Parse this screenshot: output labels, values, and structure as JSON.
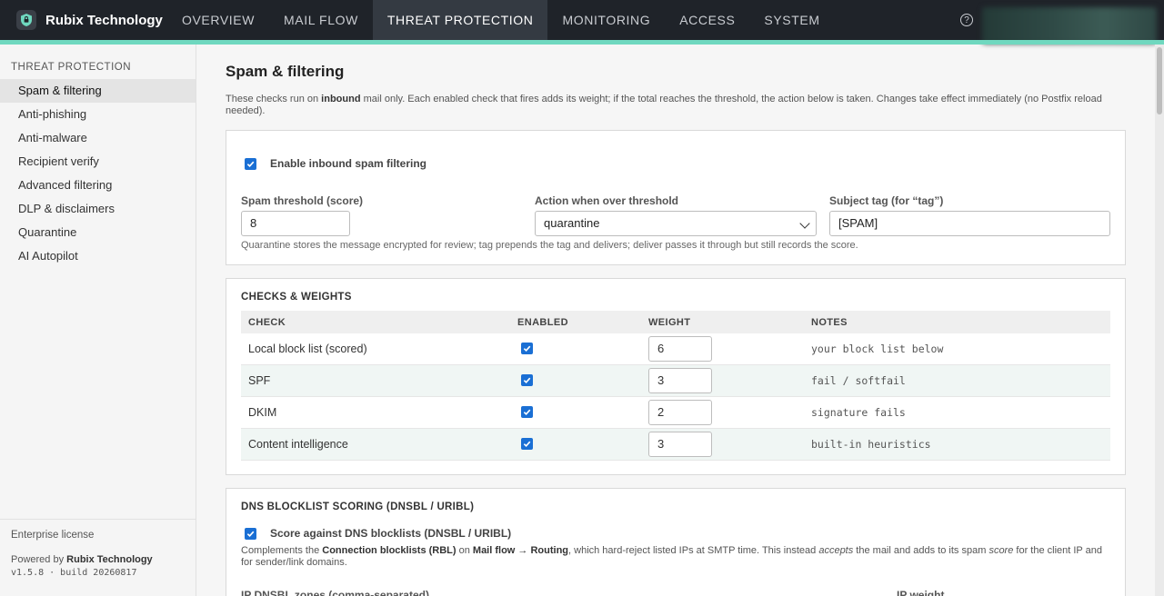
{
  "brand": {
    "name": "Rubix Technology"
  },
  "nav": [
    {
      "label": "OVERVIEW"
    },
    {
      "label": "MAIL FLOW"
    },
    {
      "label": "THREAT PROTECTION"
    },
    {
      "label": "MONITORING"
    },
    {
      "label": "ACCESS"
    },
    {
      "label": "SYSTEM"
    }
  ],
  "help_glyph": "?",
  "sidebar": {
    "heading": "THREAT PROTECTION",
    "items": [
      {
        "label": "Spam & filtering"
      },
      {
        "label": "Anti-phishing"
      },
      {
        "label": "Anti-malware"
      },
      {
        "label": "Recipient verify"
      },
      {
        "label": "Advanced filtering"
      },
      {
        "label": "DLP & disclaimers"
      },
      {
        "label": "Quarantine"
      },
      {
        "label": "AI Autopilot"
      }
    ],
    "license": "Enterprise license",
    "powered_prefix": "Powered by ",
    "powered_name": "Rubix Technology",
    "version": "v1.5.8 · build 20260817"
  },
  "page": {
    "title": "Spam & filtering",
    "intro_1": "These checks run on ",
    "intro_bold": "inbound",
    "intro_2": " mail only. Each enabled check that fires adds its weight; if the total reaches the threshold, the action below is taken. Changes take effect immediately (no Postfix reload needed)."
  },
  "settings": {
    "enable_label": "Enable inbound spam filtering",
    "enabled": true,
    "threshold_label": "Spam threshold (score)",
    "threshold_value": "8",
    "action_label": "Action when over threshold",
    "action_value": "quarantine",
    "tag_label": "Subject tag (for “tag”)",
    "tag_value": "[SPAM]",
    "hint": "Quarantine stores the message encrypted for review; tag prepends the tag and delivers; deliver passes it through but still records the score."
  },
  "checks": {
    "title": "CHECKS & WEIGHTS",
    "headers": {
      "check": "CHECK",
      "enabled": "ENABLED",
      "weight": "WEIGHT",
      "notes": "NOTES"
    },
    "rows": [
      {
        "check": "Local block list (scored)",
        "enabled": true,
        "weight": "6",
        "notes": "your block list below"
      },
      {
        "check": "SPF",
        "enabled": true,
        "weight": "3",
        "notes": "fail / softfail"
      },
      {
        "check": "DKIM",
        "enabled": true,
        "weight": "2",
        "notes": "signature fails"
      },
      {
        "check": "Content intelligence",
        "enabled": true,
        "weight": "3",
        "notes": "built-in heuristics"
      }
    ]
  },
  "dnsbl": {
    "title": "DNS BLOCKLIST SCORING (DNSBL / URIBL)",
    "enable_label": "Score against DNS blocklists (DNSBL / URIBL)",
    "enabled": true,
    "desc_1": "Complements the ",
    "desc_b1": "Connection blocklists (RBL)",
    "desc_2": " on ",
    "desc_b2": "Mail flow → Routing",
    "desc_3": ", which hard-reject listed IPs at SMTP time. This instead ",
    "desc_i1": "accepts",
    "desc_4": " the mail and adds to its spam ",
    "desc_i2": "score",
    "desc_5": " for the client IP and for sender/link domains.",
    "ip_zones_label": "IP DNSBL zones (comma-separated)",
    "ip_weight_label": "IP weight"
  }
}
